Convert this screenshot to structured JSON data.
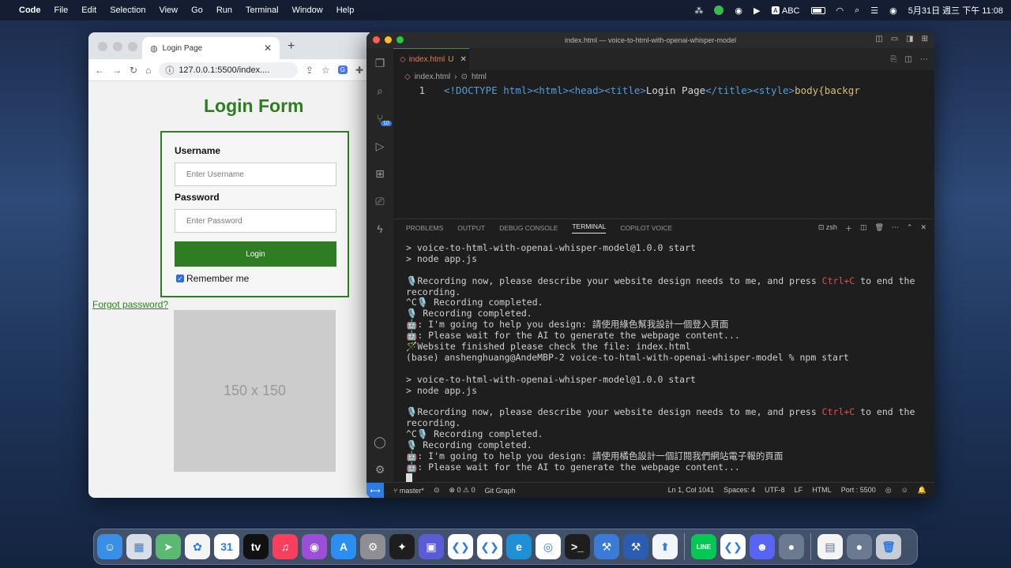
{
  "menubar": {
    "app_name": "Code",
    "items": [
      "File",
      "Edit",
      "Selection",
      "View",
      "Go",
      "Run",
      "Terminal",
      "Window",
      "Help"
    ],
    "input_method": "ABC",
    "clock": "5月31日 週三 下午 11:08"
  },
  "browser": {
    "tab_title": "Login Page",
    "url": "127.0.0.1:5500/index....",
    "page": {
      "title": "Login Form",
      "username_label": "Username",
      "username_placeholder": "Enter Username",
      "password_label": "Password",
      "password_placeholder": "Enter Password",
      "login_button": "Login",
      "remember_me": "Remember me",
      "forgot_password": "Forgot password?",
      "image_placeholder": "150 x 150",
      "accent_color": "#2e7d22"
    }
  },
  "vscode": {
    "window_title": "index.html — voice-to-html-with-openai-whisper-model",
    "tab_name": "index.html",
    "tab_status": "U",
    "breadcrumb": [
      "index.html",
      "html"
    ],
    "source_control_badge": "10",
    "code": {
      "line_number": "1",
      "doctype": "<!DOCTYPE html>",
      "html_open": "<html>",
      "head_open": "<head>",
      "title_open": "<title>",
      "title_text": "Login Page",
      "title_close": "</title>",
      "style_open": "<style>",
      "css_start": "body{backgr"
    },
    "panel_tabs": [
      "PROBLEMS",
      "OUTPUT",
      "DEBUG CONSOLE",
      "TERMINAL",
      "COPILOT VOICE"
    ],
    "active_panel_tab": "TERMINAL",
    "shell": "zsh",
    "terminal_lines": [
      "> voice-to-html-with-openai-whisper-model@1.0.0 start",
      "> node app.js",
      "",
      "🎙️Recording now, please describe your website design needs to me, and press |Ctrl+C| to end the",
      "recording.",
      "^C🎙️ Recording completed.",
      "🎙️ Recording completed.",
      "🤖: I'm going to help you design: 請使用綠色幫我設計一個登入頁面",
      "🤖: Please wait for the AI to generate the webpage content...",
      "🪄Website finished please check the file: index.html",
      "(base) anshenghuang@AndeMBP-2 voice-to-html-with-openai-whisper-model % npm start",
      "",
      "> voice-to-html-with-openai-whisper-model@1.0.0 start",
      "> node app.js",
      "",
      "🎙️Recording now, please describe your website design needs to me, and press |Ctrl+C| to end the",
      "recording.",
      "^C🎙️ Recording completed.",
      "🎙️ Recording completed.",
      "🤖: I'm going to help you design: 請使用橘色設計一個訂閱我們網站電子報的頁面",
      "🤖: Please wait for the AI to generate the webpage content..."
    ],
    "status": {
      "branch": "master*",
      "problems": "⊗ 0 ⚠ 0",
      "git_graph": "Git Graph",
      "cursor": "Ln 1, Col 1041",
      "spaces": "Spaces: 4",
      "encoding": "UTF-8",
      "eol": "LF",
      "language": "HTML",
      "port": "Port : 5500"
    }
  },
  "dock": {
    "apps": [
      {
        "name": "finder-icon",
        "color": "#3a8ee6",
        "glyph": "☺"
      },
      {
        "name": "launchpad-icon",
        "color": "#d8dde6",
        "glyph": "▦"
      },
      {
        "name": "maps-icon",
        "color": "#5bb974",
        "glyph": "➤"
      },
      {
        "name": "photos-icon",
        "color": "#f4f4f4",
        "glyph": "✿"
      },
      {
        "name": "calendar-icon",
        "color": "#ffffff",
        "glyph": "31"
      },
      {
        "name": "apple-tv-icon",
        "color": "#111111",
        "glyph": "tv"
      },
      {
        "name": "music-icon",
        "color": "#fa3e5d",
        "glyph": "♫"
      },
      {
        "name": "podcasts-icon",
        "color": "#9b4fd6",
        "glyph": "◉"
      },
      {
        "name": "app-store-icon",
        "color": "#2b8ef0",
        "glyph": "A"
      },
      {
        "name": "system-settings-icon",
        "color": "#8e8e93",
        "glyph": "⚙"
      },
      {
        "name": "figma-icon",
        "color": "#1e1e1e",
        "glyph": "✦"
      },
      {
        "name": "preview-icon",
        "color": "#5b5bd6",
        "glyph": "▣"
      },
      {
        "name": "vscode-icon",
        "color": "#ffffff",
        "glyph": "❮❯"
      },
      {
        "name": "vscode-insiders-icon",
        "color": "#ffffff",
        "glyph": "❮❯"
      },
      {
        "name": "edge-icon",
        "color": "#1f8fd6",
        "glyph": "e"
      },
      {
        "name": "chrome-icon",
        "color": "#ffffff",
        "glyph": "◎"
      },
      {
        "name": "terminal-icon",
        "color": "#1e1e1e",
        "glyph": ">_"
      },
      {
        "name": "xcode-icon",
        "color": "#3a7bd5",
        "glyph": "⚒"
      },
      {
        "name": "xcode-beta-icon",
        "color": "#2a5db0",
        "glyph": "⚒"
      },
      {
        "name": "transporter-icon",
        "color": "#f2f6fc",
        "glyph": "⬆"
      },
      {
        "name": "line-icon",
        "color": "#06c755",
        "glyph": "LINE"
      },
      {
        "name": "vscode-recent-icon",
        "color": "#ffffff",
        "glyph": "❮❯"
      },
      {
        "name": "discord-icon",
        "color": "#5865f2",
        "glyph": "☻"
      },
      {
        "name": "screen-recorder-icon",
        "color": "#6b7a90",
        "glyph": "●"
      },
      {
        "name": "document-icon",
        "color": "#f4f4f4",
        "glyph": "▤"
      },
      {
        "name": "recorder-icon",
        "color": "#6b7a90",
        "glyph": "●"
      },
      {
        "name": "trash-icon",
        "color": "#c8cdd5",
        "glyph": "🗑"
      }
    ]
  }
}
